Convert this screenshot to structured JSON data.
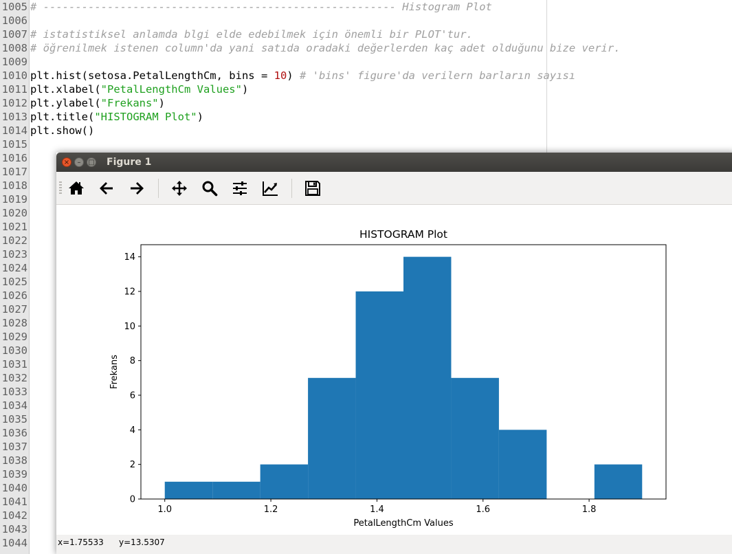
{
  "editor": {
    "lines": [
      {
        "n": "1005",
        "tokens": [
          {
            "t": "# ------------------------------------------------------- Histogram Plot",
            "c": "comment"
          }
        ]
      },
      {
        "n": "1006",
        "tokens": []
      },
      {
        "n": "1007",
        "tokens": [
          {
            "t": "# istatistiksel anlamda blgi elde edebilmek için önemli bir PLOT'tur.",
            "c": "comment"
          }
        ]
      },
      {
        "n": "1008",
        "tokens": [
          {
            "t": "# öğrenilmek istenen column'da yani satıda oradaki değerlerden kaç adet olduğunu bize verir.",
            "c": "comment"
          }
        ]
      },
      {
        "n": "1009",
        "tokens": []
      },
      {
        "n": "1010",
        "tokens": [
          {
            "t": "plt.hist(setosa.PetalLengthCm, bins = ",
            "c": ""
          },
          {
            "t": "10",
            "c": "number"
          },
          {
            "t": ") ",
            "c": ""
          },
          {
            "t": "# 'bins' figure'da verilern barların sayısı",
            "c": "comment"
          }
        ]
      },
      {
        "n": "1011",
        "tokens": [
          {
            "t": "plt.xlabel(",
            "c": ""
          },
          {
            "t": "\"PetalLengthCm Values\"",
            "c": "string"
          },
          {
            "t": ")",
            "c": ""
          }
        ]
      },
      {
        "n": "1012",
        "tokens": [
          {
            "t": "plt.ylabel(",
            "c": ""
          },
          {
            "t": "\"Frekans\"",
            "c": "string"
          },
          {
            "t": ")",
            "c": ""
          }
        ]
      },
      {
        "n": "1013",
        "tokens": [
          {
            "t": "plt.title(",
            "c": ""
          },
          {
            "t": "\"HISTOGRAM Plot\"",
            "c": "string"
          },
          {
            "t": ")",
            "c": ""
          }
        ]
      },
      {
        "n": "1014",
        "tokens": [
          {
            "t": "plt.show()",
            "c": ""
          }
        ]
      },
      {
        "n": "1015",
        "tokens": []
      },
      {
        "n": "1016",
        "tokens": []
      },
      {
        "n": "1017",
        "tokens": []
      },
      {
        "n": "1018",
        "tokens": []
      },
      {
        "n": "1019",
        "tokens": []
      },
      {
        "n": "1020",
        "tokens": []
      },
      {
        "n": "1021",
        "tokens": []
      },
      {
        "n": "1022",
        "tokens": []
      },
      {
        "n": "1023",
        "tokens": []
      },
      {
        "n": "1024",
        "tokens": []
      },
      {
        "n": "1025",
        "tokens": []
      },
      {
        "n": "1026",
        "tokens": []
      },
      {
        "n": "1027",
        "tokens": []
      },
      {
        "n": "1028",
        "tokens": []
      },
      {
        "n": "1029",
        "tokens": []
      },
      {
        "n": "1030",
        "tokens": []
      },
      {
        "n": "1031",
        "tokens": []
      },
      {
        "n": "1032",
        "tokens": []
      },
      {
        "n": "1033",
        "tokens": []
      },
      {
        "n": "1034",
        "tokens": []
      },
      {
        "n": "1035",
        "tokens": []
      },
      {
        "n": "1036",
        "tokens": []
      },
      {
        "n": "1037",
        "tokens": []
      },
      {
        "n": "1038",
        "tokens": []
      },
      {
        "n": "1039",
        "tokens": []
      },
      {
        "n": "1040",
        "tokens": []
      },
      {
        "n": "1041",
        "tokens": []
      },
      {
        "n": "1042",
        "tokens": []
      },
      {
        "n": "1043",
        "tokens": []
      },
      {
        "n": "1044",
        "tokens": []
      }
    ]
  },
  "figure_window": {
    "title": "Figure 1",
    "close_glyph": "×",
    "minimize_glyph": "–",
    "maximize_glyph": "□",
    "toolbar": [
      "home-icon",
      "back-arrow-icon",
      "forward-arrow-icon",
      "pan-icon",
      "zoom-icon",
      "subplots-icon",
      "edit-axes-icon",
      "save-icon"
    ],
    "status": {
      "x": "x=1.75533",
      "y": "y=13.5307"
    }
  },
  "chart_data": {
    "type": "bar",
    "title": "HISTOGRAM Plot",
    "xlabel": "PetalLengthCm Values",
    "ylabel": "Frekans",
    "bin_edges": [
      1.0,
      1.09,
      1.18,
      1.27,
      1.36,
      1.45,
      1.54,
      1.63,
      1.72,
      1.81,
      1.9
    ],
    "values": [
      1,
      1,
      2,
      7,
      12,
      14,
      7,
      4,
      0,
      2
    ],
    "xlim": [
      0.955,
      1.945
    ],
    "ylim": [
      0,
      14.7
    ],
    "xticks": [
      1.0,
      1.2,
      1.4,
      1.6,
      1.8
    ],
    "xtick_labels": [
      "1.0",
      "1.2",
      "1.4",
      "1.6",
      "1.8"
    ],
    "yticks": [
      0,
      2,
      4,
      6,
      8,
      10,
      12,
      14
    ],
    "ytick_labels": [
      "0",
      "2",
      "4",
      "6",
      "8",
      "10",
      "12",
      "14"
    ],
    "bar_color": "#1f77b4",
    "grid": false
  }
}
